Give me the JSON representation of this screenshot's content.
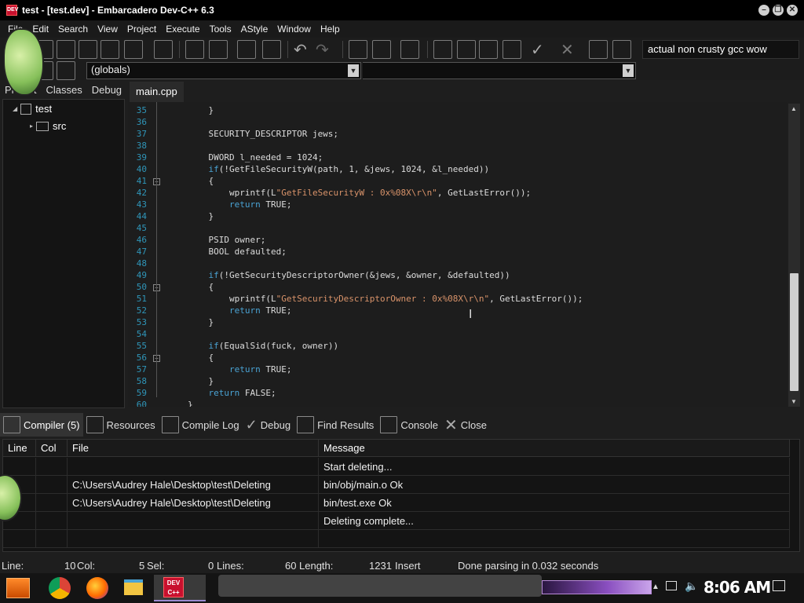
{
  "window": {
    "title": "test - [test.dev] - Embarcadero Dev-C++ 6.3",
    "app_icon_text": "DEV"
  },
  "menu": [
    "File",
    "Edit",
    "Search",
    "View",
    "Project",
    "Execute",
    "Tools",
    "AStyle",
    "Window",
    "Help"
  ],
  "toolbar": {
    "compiler": "actual non crusty gcc wow"
  },
  "combos": {
    "class_select": "",
    "member_select": "(globals)"
  },
  "left_panel": {
    "tabs": [
      "Project",
      "Classes",
      "Debug"
    ],
    "tree": {
      "root": "test",
      "child": "src"
    }
  },
  "editor": {
    "tab": "main.cpp",
    "lines": [
      {
        "n": "35",
        "html": "    }"
      },
      {
        "n": "36",
        "html": ""
      },
      {
        "n": "37",
        "html": "    SECURITY_DESCRIPTOR jews;"
      },
      {
        "n": "38",
        "html": ""
      },
      {
        "n": "39",
        "html": "    DWORD l_needed = 1024;"
      },
      {
        "n": "40",
        "html": "    <span class=\"kw\">if</span>(!GetFileSecurityW(path, 1, &amp;jews, 1024, &amp;l_needed))"
      },
      {
        "n": "41",
        "html": "    {"
      },
      {
        "n": "42",
        "html": "        wprintf(L<span class=\"str\">\"GetFileSecurityW : 0x%08X\\r\\n\"</span>, GetLastError());"
      },
      {
        "n": "43",
        "html": "        <span class=\"kw\">return</span> TRUE;"
      },
      {
        "n": "44",
        "html": "    }"
      },
      {
        "n": "45",
        "html": ""
      },
      {
        "n": "46",
        "html": "    PSID owner;"
      },
      {
        "n": "47",
        "html": "    BOOL defaulted;"
      },
      {
        "n": "48",
        "html": ""
      },
      {
        "n": "49",
        "html": "    <span class=\"kw\">if</span>(!GetSecurityDescriptorOwner(&amp;jews, &amp;owner, &amp;defaulted))"
      },
      {
        "n": "50",
        "html": "    {"
      },
      {
        "n": "51",
        "html": "        wprintf(L<span class=\"str\">\"GetSecurityDescriptorOwner : 0x%08X\\r\\n\"</span>, GetLastError());"
      },
      {
        "n": "52",
        "html": "        <span class=\"kw\">return</span> TRUE;"
      },
      {
        "n": "53",
        "html": "    }"
      },
      {
        "n": "54",
        "html": ""
      },
      {
        "n": "55",
        "html": "    <span class=\"kw\">if</span>(EqualSid(fuck, owner))"
      },
      {
        "n": "56",
        "html": "    {"
      },
      {
        "n": "57",
        "html": "        <span class=\"kw\">return</span> TRUE;"
      },
      {
        "n": "58",
        "html": "    }"
      },
      {
        "n": "59",
        "html": "    <span class=\"kw\">return</span> FALSE;"
      },
      {
        "n": "60",
        "html": "}"
      }
    ]
  },
  "bottom_tabs": [
    "Compiler (5)",
    "Resources",
    "Compile Log",
    "Debug",
    "Find Results",
    "Console",
    "Close"
  ],
  "messages": {
    "headers": [
      "Line",
      "Col",
      "File",
      "Message"
    ],
    "rows": [
      {
        "line": "",
        "col": "",
        "file": "",
        "message": "Start deleting..."
      },
      {
        "line": "",
        "col": "",
        "file": "C:\\Users\\Audrey Hale\\Desktop\\test\\Deleting",
        "message": "bin/obj/main.o Ok"
      },
      {
        "line": "",
        "col": "",
        "file": "C:\\Users\\Audrey Hale\\Desktop\\test\\Deleting",
        "message": "bin/test.exe Ok"
      },
      {
        "line": "",
        "col": "",
        "file": "",
        "message": "Deleting complete..."
      }
    ]
  },
  "status": {
    "line_label": "Line:",
    "line_value": "10",
    "col_label": "Col:",
    "col_value": "5",
    "sel_label": "Sel:",
    "sel_value": "0",
    "lines_label": "Lines:",
    "lines_value": "60",
    "length_label": "Length:",
    "length_value": "1231",
    "mode": "Insert",
    "message": "Done parsing in 0.032 seconds"
  },
  "taskbar": {
    "clock": "8:06 AM",
    "active_app": "DEV C++"
  }
}
